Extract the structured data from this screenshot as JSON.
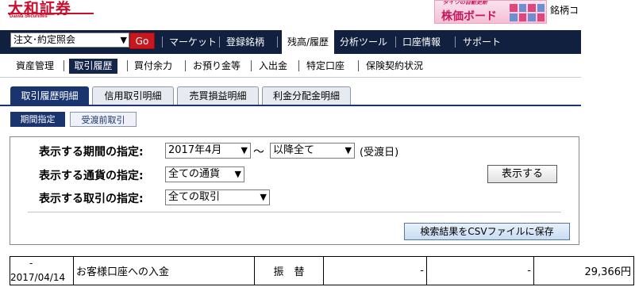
{
  "header": {
    "logo_main": "大和証券",
    "logo_sub": "Daiwa Securities",
    "banner_small": "ダイワの自動更新",
    "banner_main": "株価ボード",
    "brand_cut": "銘柄コ"
  },
  "navbar": {
    "order_select": "注文･約定照会",
    "go_label": "Go",
    "items": [
      "マーケット",
      "登録銘柄",
      "残高/履歴",
      "分析ツール",
      "口座情報",
      "サポート"
    ],
    "active": "残高/履歴"
  },
  "subnav": {
    "items": [
      "資産管理",
      "取引履歴",
      "買付余力",
      "お預り金等",
      "入出金",
      "特定口座",
      "保険契約状況"
    ],
    "active": "取引履歴"
  },
  "tabs": {
    "items": [
      "取引履歴明細",
      "信用取引明細",
      "売買損益明細",
      "利金分配金明細"
    ],
    "active": "取引履歴明細"
  },
  "chips": {
    "period": "期間指定",
    "pre_delivery": "受渡前取引"
  },
  "filters": {
    "period_label": "表示する期間の指定:",
    "period_from": "2017年4月",
    "tilde": "～",
    "period_to": "以降全て",
    "period_suffix": "(受渡日)",
    "currency_label": "表示する通貨の指定:",
    "currency_value": "全ての通貨",
    "trade_label": "表示する取引の指定:",
    "trade_value": "全ての取引",
    "show_button": "表示する",
    "csv_button": "検索結果をCSVファイルに保存"
  },
  "results": {
    "rows": [
      {
        "date_top": "-",
        "date": "2017/04/14",
        "description": "お客様口座への入金",
        "type": "振　替",
        "col4": "-",
        "col5": "-",
        "amount": "29,366円"
      }
    ]
  },
  "colors": {
    "nav_bg": "#10203e",
    "brand_red": "#c8102e",
    "tab_active": "#1a3470"
  }
}
